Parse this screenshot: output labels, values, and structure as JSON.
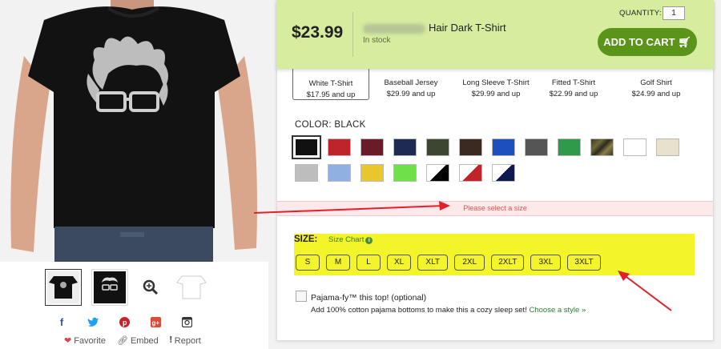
{
  "header": {
    "price": "$23.99",
    "product_name": "Hair Dark T-Shirt",
    "stock": "In stock",
    "quantity_label": "QUANTITY:",
    "quantity_value": "1",
    "add_to_cart": "ADD TO CART"
  },
  "styles": [
    {
      "name": "White T-Shirt",
      "price": "$17.95 and up",
      "selected": true
    },
    {
      "name": "Baseball Jersey",
      "price": "$29.99 and up"
    },
    {
      "name": "Long Sleeve T-Shirt",
      "price": "$29.99 and up"
    },
    {
      "name": "Fitted T-Shirt",
      "price": "$22.99 and up"
    },
    {
      "name": "Golf Shirt",
      "price": "$24.99 and up"
    }
  ],
  "color": {
    "label": "COLOR: BLACK",
    "swatches": [
      {
        "color": "#111111",
        "selected": true
      },
      {
        "color": "#c0242b"
      },
      {
        "color": "#6b1a2a"
      },
      {
        "color": "#1f2a52"
      },
      {
        "color": "#3c4630"
      },
      {
        "color": "#3a2a22"
      },
      {
        "color": "#1d4fbf"
      },
      {
        "color": "#555555"
      },
      {
        "color": "#2e9a4a"
      },
      {
        "color": "camo"
      },
      {
        "color": "#ffffff"
      },
      {
        "color": "#e7e2cc"
      },
      {
        "color": "#bdbdbd"
      },
      {
        "color": "#8fb0e0"
      },
      {
        "color": "#e8c72e"
      },
      {
        "color": "#6fe04a"
      },
      {
        "color": "black-white"
      },
      {
        "color": "red-white"
      },
      {
        "color": "navy-white"
      }
    ]
  },
  "alert": "Please select a size",
  "size": {
    "label": "SIZE:",
    "chart_link": "Size Chart",
    "options": [
      "S",
      "M",
      "L",
      "XL",
      "XLT",
      "2XL",
      "2XLT",
      "3XL",
      "3XLT"
    ]
  },
  "pajama": {
    "title": "Pajama-fy™ this top! (optional)",
    "subtitle": "Add 100% cotton pajama bottoms to make this a cozy sleep set!",
    "link": "Choose a style »"
  },
  "actions": {
    "favorite": "Favorite",
    "embed": "Embed",
    "report": "Report"
  },
  "colors": {
    "sticky_bg": "#d6ec9e",
    "cart_button": "#5a9418",
    "highlight": "#f3f42a",
    "annotation": "#e3202a"
  }
}
